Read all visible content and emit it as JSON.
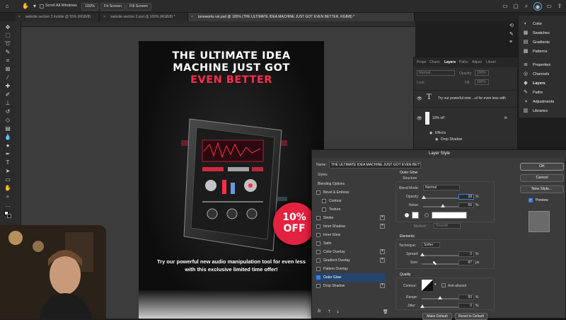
{
  "options_bar": {
    "scroll_all_label": "Scroll All Windows",
    "zoom_label": "100%",
    "fit_screen_label": "Fit Screen",
    "fill_screen_label": "Fill Screen"
  },
  "tabs": [
    {
      "label": "website section 2 mobile @ 55% (RGB/8)"
    },
    {
      "label": "website section 2.psd @ 100% (RGB/8) *"
    },
    {
      "label": "toneworks vst.psd @ 105% (THE ULTIMATE IDEA MACHINE JUST GOT EVEN BETTER, RGB/8) *"
    }
  ],
  "poster": {
    "title_line1": "THE ULTIMATE IDEA",
    "title_line2": "MACHINE JUST GOT",
    "title_line3": "EVEN BETTER",
    "badge_line1": "10%",
    "badge_line2": "OFF",
    "tagline": "Try our powerful new audio manipulation tool for even less with this exclusive limited time offer!",
    "title_accent_color": "#ff2c4a",
    "badge_color": "#e32240"
  },
  "layers_panel": {
    "tabs": [
      "Prope",
      "Chann",
      "Layers",
      "Paths",
      "Adjust",
      "Librari"
    ],
    "active_tab": "Layers",
    "blend_mode": "Normal",
    "opacity_label": "Opacity:",
    "opacity_value": "100%",
    "lock_label": "Lock:",
    "fill_label": "Fill:",
    "fill_value": "100%",
    "layers": [
      {
        "name": "Try our powerful new ...ol for even less with",
        "kind": "text"
      },
      {
        "name": "10% off",
        "kind": "shape",
        "fx": "fx"
      }
    ],
    "effects_label": "Effects",
    "effect_item": "Drop Shadow"
  },
  "dock": {
    "items": [
      {
        "label": "Color",
        "icon": "color-wheel-icon"
      },
      {
        "label": "Swatches",
        "icon": "swatches-icon"
      },
      {
        "label": "Gradients",
        "icon": "gradient-icon"
      },
      {
        "label": "Patterns",
        "icon": "pattern-icon"
      },
      {
        "label": "Properties",
        "icon": "properties-icon"
      },
      {
        "label": "Channels",
        "icon": "channels-icon"
      },
      {
        "label": "Layers",
        "icon": "layers-icon"
      },
      {
        "label": "Paths",
        "icon": "paths-icon"
      },
      {
        "label": "Adjustments",
        "icon": "adjustments-icon"
      },
      {
        "label": "Libraries",
        "icon": "libraries-icon"
      }
    ]
  },
  "layer_style": {
    "title": "Layer Style",
    "name_label": "Name:",
    "name_value": "THE ULTIMATE IDEA MACHINE JUST GOT EVEN BETTER",
    "styles_header": "Styles",
    "styles": [
      {
        "label": "Blending Options",
        "checkbox": false,
        "plus": false,
        "checked": false,
        "selected": false
      },
      {
        "label": "Bevel & Emboss",
        "checkbox": true,
        "plus": false,
        "checked": false,
        "selected": false
      },
      {
        "label": "Contour",
        "checkbox": true,
        "plus": false,
        "checked": false,
        "selected": false,
        "indent": true
      },
      {
        "label": "Texture",
        "checkbox": true,
        "plus": false,
        "checked": false,
        "selected": false,
        "indent": true
      },
      {
        "label": "Stroke",
        "checkbox": true,
        "plus": true,
        "checked": false,
        "selected": false
      },
      {
        "label": "Inner Shadow",
        "checkbox": true,
        "plus": true,
        "checked": false,
        "selected": false
      },
      {
        "label": "Inner Glow",
        "checkbox": true,
        "plus": false,
        "checked": false,
        "selected": false
      },
      {
        "label": "Satin",
        "checkbox": true,
        "plus": false,
        "checked": false,
        "selected": false
      },
      {
        "label": "Color Overlay",
        "checkbox": true,
        "plus": true,
        "checked": false,
        "selected": false
      },
      {
        "label": "Gradient Overlay",
        "checkbox": true,
        "plus": true,
        "checked": false,
        "selected": false
      },
      {
        "label": "Pattern Overlay",
        "checkbox": true,
        "plus": false,
        "checked": false,
        "selected": false
      },
      {
        "label": "Outer Glow",
        "checkbox": true,
        "plus": false,
        "checked": true,
        "selected": true
      },
      {
        "label": "Drop Shadow",
        "checkbox": true,
        "plus": true,
        "checked": false,
        "selected": false
      }
    ],
    "section_title": "Outer Glow",
    "structure_label": "Structure",
    "blend_mode_label": "Blend Mode:",
    "blend_mode_value": "Normal",
    "opacity_label": "Opacity:",
    "opacity_value": "10",
    "noise_label": "Noise:",
    "noise_value": "56",
    "method_label": "Method:",
    "method_value": "Smooth",
    "elements_label": "Elements",
    "technique_label": "Technique:",
    "technique_value": "Softer",
    "spread_label": "Spread:",
    "spread_value": "0",
    "size_label": "Size:",
    "size_value": "87",
    "quality_label": "Quality",
    "contour_label": "Contour:",
    "anti_aliased_label": "Anti-aliased",
    "range_label": "Range:",
    "range_value": "50",
    "jitter_label": "Jitter:",
    "jitter_value": "0",
    "percent_unit": "%",
    "px_unit": "px",
    "make_default_label": "Make Default",
    "reset_default_label": "Reset to Default",
    "ok_label": "OK",
    "cancel_label": "Cancel",
    "new_style_label": "New Style...",
    "preview_label": "Preview",
    "fx_label": "fx"
  }
}
